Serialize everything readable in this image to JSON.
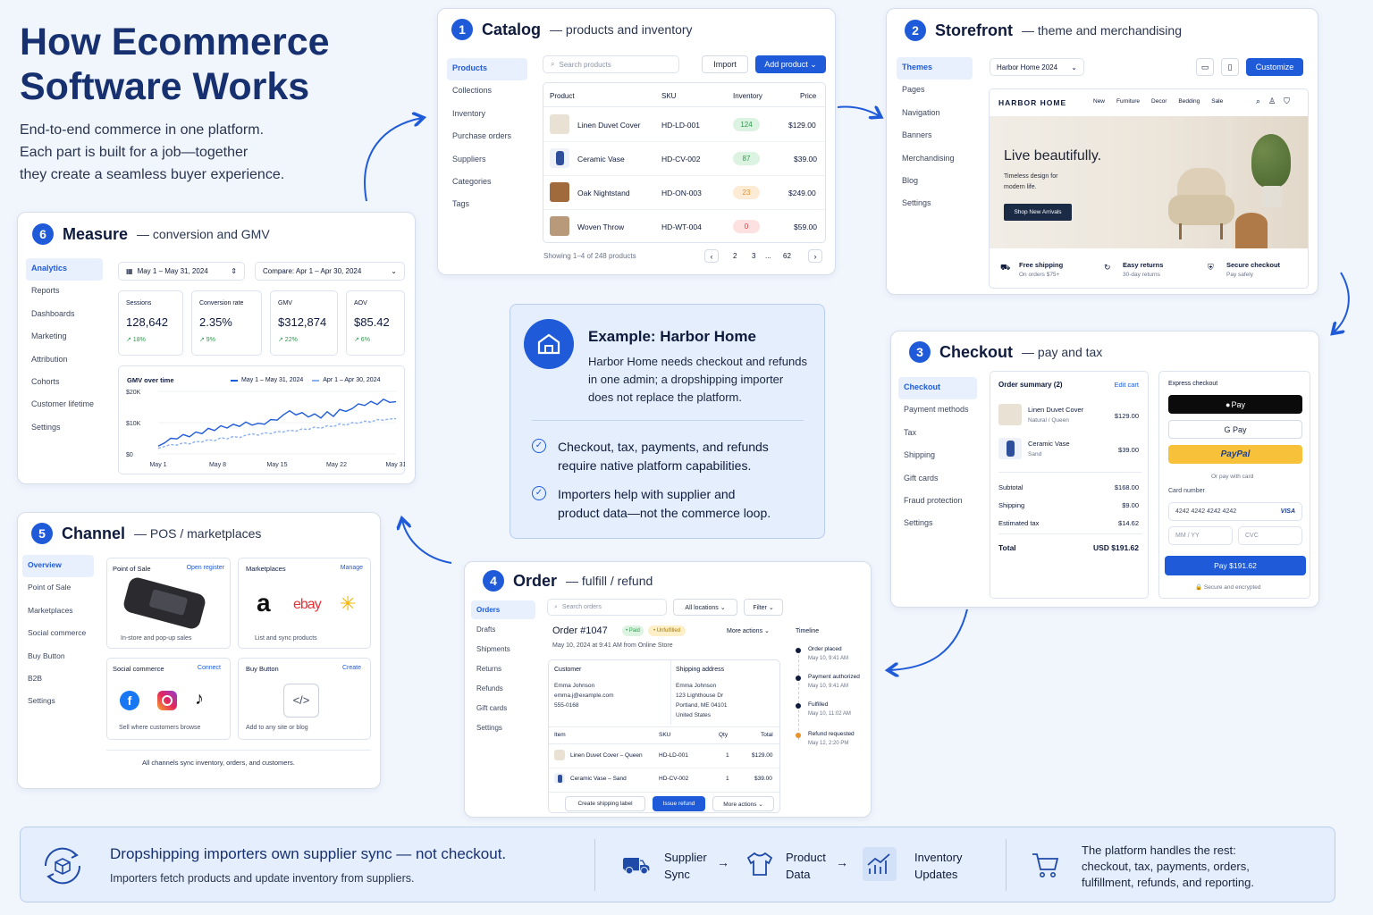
{
  "hero": {
    "title1": "How Ecommerce",
    "title2": "Software Works",
    "sub1": "End-to-end commerce in one platform.",
    "sub2": "Each part is built for a job—together",
    "sub3": "they create a seamless buyer experience."
  },
  "catalog": {
    "num": "1",
    "title": "Catalog",
    "sub": "— products and inventory",
    "nav": [
      "Products",
      "Collections",
      "Inventory",
      "Purchase orders",
      "Suppliers",
      "Categories",
      "Tags"
    ],
    "search": "Search products",
    "import": "Import",
    "add": "Add product ⌄",
    "cols": [
      "Product",
      "SKU",
      "Inventory",
      "Price"
    ],
    "rows": [
      {
        "name": "Linen Duvet Cover",
        "sku": "HD-LD-001",
        "inv": "124",
        "price": "$129.00"
      },
      {
        "name": "Ceramic Vase",
        "sku": "HD-CV-002",
        "inv": "87",
        "price": "$39.00"
      },
      {
        "name": "Oak Nightstand",
        "sku": "HD-ON-003",
        "inv": "23",
        "price": "$249.00"
      },
      {
        "name": "Woven Throw",
        "sku": "HD-WT-004",
        "inv": "0",
        "price": "$59.00"
      }
    ],
    "showing": "Showing 1–4 of 248 products",
    "pages": [
      "‹",
      "2",
      "3",
      "...",
      "62",
      "›"
    ]
  },
  "storefront": {
    "num": "2",
    "title": "Storefront",
    "sub": "— theme and merchandising",
    "nav": [
      "Themes",
      "Pages",
      "Navigation",
      "Banners",
      "Merchandising",
      "Blog",
      "Settings"
    ],
    "theme": "Harbor Home 2024",
    "customize": "Customize",
    "brand": "HARBOR HOME",
    "menu": [
      "New",
      "Furniture",
      "Decor",
      "Bedding",
      "Sale"
    ],
    "headline": "Live beautifully.",
    "tag1": "Timeless design for",
    "tag2": "modern life.",
    "shop": "Shop New Arrivals",
    "perks": [
      {
        "t": "Free shipping",
        "s": "On orders $75+"
      },
      {
        "t": "Easy returns",
        "s": "30-day returns"
      },
      {
        "t": "Secure checkout",
        "s": "Pay safely"
      }
    ]
  },
  "checkout": {
    "num": "3",
    "title": "Checkout",
    "sub": "— pay and tax",
    "nav": [
      "Checkout",
      "Payment methods",
      "Tax",
      "Shipping",
      "Gift cards",
      "Fraud protection",
      "Settings"
    ],
    "summary": "Order summary (2)",
    "edit": "Edit cart",
    "items": [
      {
        "n": "Linen Duvet Cover",
        "v": "Natural / Queen",
        "p": "$129.00"
      },
      {
        "n": "Ceramic Vase",
        "v": "Sand",
        "p": "$39.00"
      }
    ],
    "lines": [
      {
        "l": "Subtotal",
        "v": "$168.00"
      },
      {
        "l": "Shipping",
        "v": "$9.00"
      },
      {
        "l": "Estimated tax",
        "v": "$14.62"
      }
    ],
    "total_l": "Total",
    "total_v": "USD $191.62",
    "express": "Express checkout",
    "apple": " Pay",
    "gpay": "G Pay",
    "paypal": "PayPal",
    "or": "Or pay with card",
    "cardl": "Card number",
    "cardn": "4242 4242 4242 4242",
    "visa": "VISA",
    "mm": "MM / YY",
    "cvc": "CVC",
    "pay": "Pay $191.62",
    "secure": "🔒 Secure and encrypted"
  },
  "example": {
    "title": "Example: Harbor Home",
    "p1": "Harbor Home needs checkout and refunds",
    "p2": "in one admin; a dropshipping importer",
    "p3": "does not replace the platform.",
    "c1a": "Checkout, tax, payments, and refunds",
    "c1b": "require native platform capabilities.",
    "c2a": "Importers help with supplier and",
    "c2b": "product data—not the commerce loop."
  },
  "measure": {
    "num": "6",
    "title": "Measure",
    "sub": "— conversion and GMV",
    "nav": [
      "Analytics",
      "Reports",
      "Dashboards",
      "Marketing",
      "Attribution",
      "Cohorts",
      "Customer lifetime",
      "Settings"
    ],
    "date": "May 1 – May 31, 2024",
    "compare": "Compare: Apr 1 – Apr 30, 2024",
    "kpis": [
      {
        "l": "Sessions",
        "v": "128,642",
        "d": "↗ 18%"
      },
      {
        "l": "Conversion rate",
        "v": "2.35%",
        "d": "↗ 9%"
      },
      {
        "l": "GMV",
        "v": "$312,874",
        "d": "↗ 22%"
      },
      {
        "l": "AOV",
        "v": "$85.42",
        "d": "↗ 6%"
      }
    ],
    "chart_title": "GMV over time",
    "leg1": "May 1 – May 31, 2024",
    "leg2": "Apr 1 – Apr 30, 2024"
  },
  "chart_data": {
    "type": "line",
    "title": "GMV over time",
    "xlabel": "",
    "ylabel": "",
    "x": [
      "May 1",
      "May 8",
      "May 15",
      "May 22",
      "May 31"
    ],
    "ylim": [
      0,
      20000
    ],
    "yticks": [
      "$20K",
      "$10K",
      "$0"
    ],
    "series": [
      {
        "name": "May 1 – May 31, 2024",
        "values": [
          2500,
          3500,
          5000,
          4800,
          6200,
          5500,
          7000,
          6500,
          8200,
          7500,
          9000,
          8300,
          9500,
          8800,
          10200,
          9200,
          9800,
          9500,
          11000,
          10800,
          12500,
          13800,
          12500,
          13200,
          11800,
          12800,
          11500,
          13500,
          12000,
          14200,
          13600,
          14500,
          16000,
          15500,
          16800,
          15800,
          17500,
          16500,
          16700
        ]
      },
      {
        "name": "Apr 1 – Apr 30, 2024",
        "values": [
          1800,
          2400,
          3000,
          2800,
          3600,
          3200,
          4000,
          3800,
          4600,
          4200,
          5200,
          4800,
          5600,
          5200,
          6000,
          6400,
          6000,
          6800,
          6500,
          7200,
          7000,
          7600,
          7300,
          8000,
          7800,
          8600,
          8200,
          9000,
          8700,
          9600,
          9200,
          10000,
          9800,
          10500,
          10200,
          11000,
          10800,
          11200,
          11300
        ]
      }
    ]
  },
  "channel": {
    "num": "5",
    "title": "Channel",
    "sub": "— POS / marketplaces",
    "nav": [
      "Overview",
      "Point of Sale",
      "Marketplaces",
      "Social commerce",
      "Buy Button",
      "B2B",
      "Settings"
    ],
    "pos": "Point of Sale",
    "pos_link": "Open register",
    "pos_note": "In-store and pop-up sales",
    "mk": "Marketplaces",
    "mk_link": "Manage",
    "mk_note": "List and sync products",
    "amazon": "a",
    "ebay": "ebay",
    "sc": "Social commerce",
    "sc_link": "Connect",
    "sc_note": "Sell where customers browse",
    "bb": "Buy Button",
    "bb_link": "Create",
    "bb_note": "Add to any site or blog",
    "code": "</>",
    "footer": "All channels sync inventory, orders, and customers."
  },
  "order": {
    "num": "4",
    "title": "Order",
    "sub": "— fulfill / refund",
    "nav": [
      "Orders",
      "Drafts",
      "Shipments",
      "Returns",
      "Refunds",
      "Gift cards",
      "Settings"
    ],
    "search": "Search orders",
    "loc": "All locations ⌄",
    "filter": "Filter ⌄",
    "id": "Order #1047",
    "paid": "• Paid",
    "unf": "• Unfulfilled",
    "more": "More actions ⌄",
    "date": "May 10, 2024 at 9:41 AM from Online Store",
    "cust_h": "Customer",
    "cust": [
      "Emma Johnson",
      "emma.j@example.com",
      "555-0168"
    ],
    "ship_h": "Shipping address",
    "ship": [
      "Emma Johnson",
      "123 Lighthouse Dr",
      "Portland, ME 04101",
      "United States"
    ],
    "cols": [
      "Item",
      "SKU",
      "Qty",
      "Total"
    ],
    "rows": [
      {
        "i": "Linen Duvet Cover – Queen",
        "s": "HD-LD-001",
        "q": "1",
        "t": "$129.00"
      },
      {
        "i": "Ceramic Vase – Sand",
        "s": "HD-CV-002",
        "q": "1",
        "t": "$39.00"
      }
    ],
    "label": "Create shipping label",
    "refund": "Issue refund",
    "more2": "More actions ⌄",
    "timeline": "Timeline",
    "tl": [
      {
        "e": "Order placed",
        "d": "May 10, 9:41 AM"
      },
      {
        "e": "Payment authorized",
        "d": "May 10, 9:41 AM"
      },
      {
        "e": "Fulfilled",
        "d": "May 10, 11:02 AM"
      },
      {
        "e": "Refund requested",
        "d": "May 12, 2:20 PM"
      }
    ]
  },
  "bottom": {
    "title": "Dropshipping importers own supplier sync — not checkout.",
    "sub": "Importers fetch products and update inventory from suppliers.",
    "s1a": "Supplier",
    "s1b": "Sync",
    "s2a": "Product",
    "s2b": "Data",
    "s3a": "Inventory",
    "s3b": "Updates",
    "r1": "The platform handles the rest:",
    "r2": "checkout, tax, payments, orders,",
    "r3": "fulfillment, refunds, and reporting."
  },
  "colors": {
    "accent": "#1f5bd8",
    "bg": "#f1f5fc",
    "green": "#2e9b4e",
    "orange": "#e8912d",
    "red": "#d93636",
    "paypal": "#f7c23a"
  }
}
